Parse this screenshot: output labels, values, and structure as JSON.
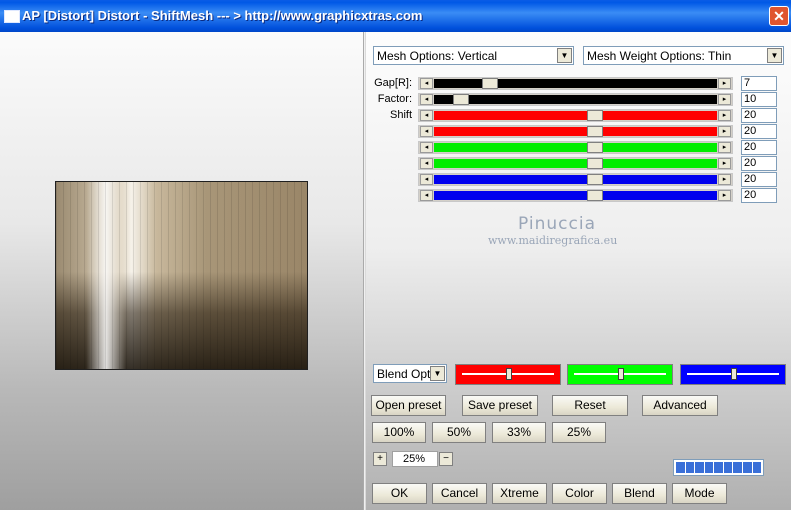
{
  "window": {
    "title": "AP [Distort]  Distort - ShiftMesh    --- > http://www.graphicxtras.com",
    "close_glyph": "✕",
    "icon": "window-icon"
  },
  "mesh_options": {
    "value": "Mesh Options: Vertical"
  },
  "mesh_weight": {
    "value": "Mesh Weight Options: Thin"
  },
  "sliders": [
    {
      "label": "Gap[R]:",
      "value": "7",
      "color": "#000000",
      "position": 0.18
    },
    {
      "label": "Factor:",
      "value": "10",
      "color": "#000000",
      "position": 0.07
    },
    {
      "label": "Shift",
      "value": "20",
      "color": "#ff0000",
      "position": 0.57
    },
    {
      "label": "",
      "value": "20",
      "color": "#ff0000",
      "position": 0.57
    },
    {
      "label": "",
      "value": "20",
      "color": "#00ee00",
      "position": 0.57
    },
    {
      "label": "",
      "value": "20",
      "color": "#00ee00",
      "position": 0.57
    },
    {
      "label": "",
      "value": "20",
      "color": "#0000ee",
      "position": 0.57
    },
    {
      "label": "",
      "value": "20",
      "color": "#0000ee",
      "position": 0.57
    }
  ],
  "watermark": {
    "name": "Pinuccia",
    "url": "www.maidiregrafica.eu"
  },
  "blend": {
    "value": "Blend Optio",
    "color_sliders": [
      {
        "color": "#ff0000",
        "position": 0.5
      },
      {
        "color": "#00ff00",
        "position": 0.5
      },
      {
        "color": "#0000ff",
        "position": 0.5
      }
    ]
  },
  "buttons": {
    "open_preset": "Open preset",
    "save_preset": "Save preset",
    "reset": "Reset",
    "advanced": "Advanced",
    "zoom_100": "100%",
    "zoom_50": "50%",
    "zoom_33": "33%",
    "zoom_25": "25%",
    "ok": "OK",
    "cancel": "Cancel",
    "xtreme": "Xtreme",
    "color": "Color",
    "blend": "Blend",
    "mode": "Mode"
  },
  "zoom": {
    "plus": "+",
    "minus": "−",
    "value": "25%"
  },
  "progress": {
    "fraction": 1.0
  },
  "arrow_down": "▼",
  "arrow_left": "◂",
  "arrow_right": "▸"
}
